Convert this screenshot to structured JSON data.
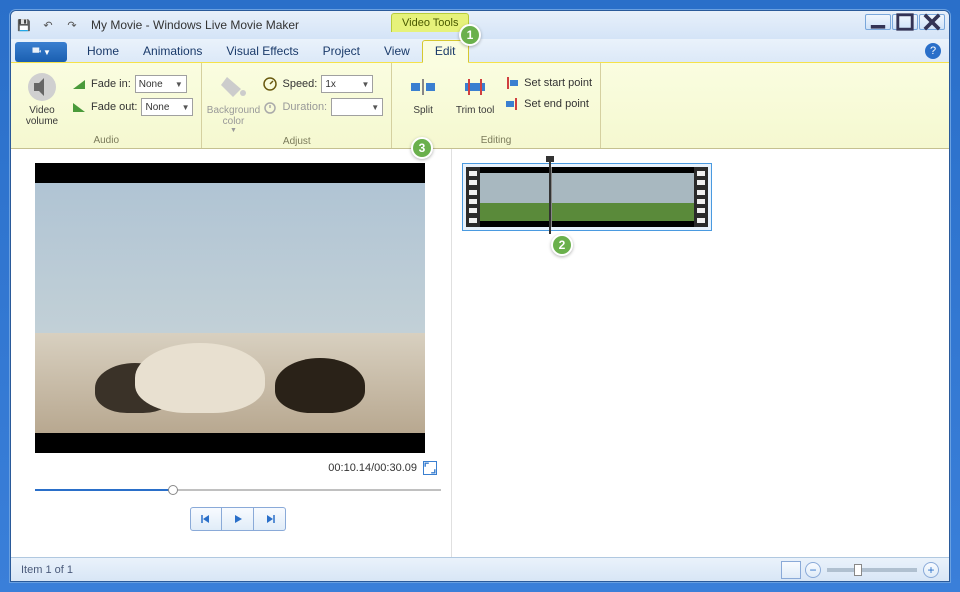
{
  "title": "My Movie - Windows Live Movie Maker",
  "context_tab": "Video Tools",
  "tabs": {
    "home": "Home",
    "animations": "Animations",
    "visual_effects": "Visual Effects",
    "project": "Project",
    "view": "View",
    "edit": "Edit"
  },
  "ribbon": {
    "audio": {
      "label": "Audio",
      "video_volume": "Video volume",
      "fade_in": "Fade in:",
      "fade_out": "Fade out:",
      "fade_in_value": "None",
      "fade_out_value": "None"
    },
    "adjust": {
      "label": "Adjust",
      "bg_color": "Background color",
      "speed": "Speed:",
      "speed_value": "1x",
      "duration": "Duration:",
      "duration_value": ""
    },
    "editing": {
      "label": "Editing",
      "split": "Split",
      "trim": "Trim tool",
      "set_start": "Set start point",
      "set_end": "Set end point"
    }
  },
  "preview": {
    "time_current": "00:10.14",
    "time_total": "00:30.09"
  },
  "status": {
    "item": "Item 1 of 1"
  },
  "callouts": {
    "1": "1",
    "2": "2",
    "3": "3"
  }
}
